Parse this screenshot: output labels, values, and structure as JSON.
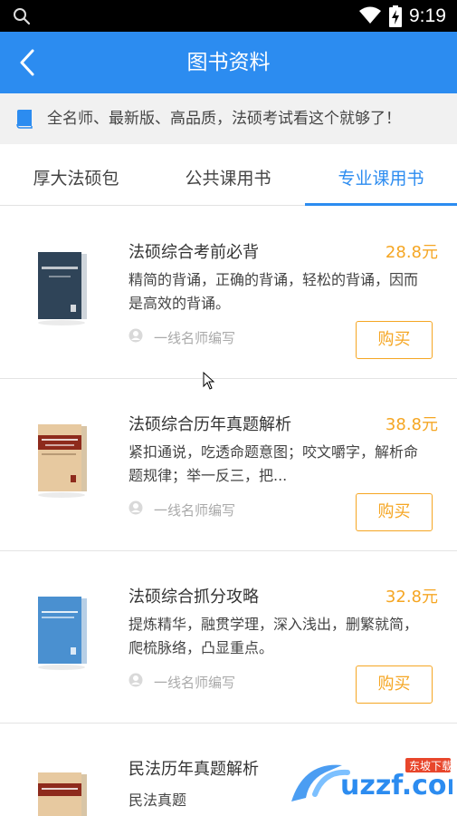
{
  "status_bar": {
    "time": "9:19"
  },
  "header": {
    "title": "图书资料"
  },
  "notice": {
    "text": "全名师、最新版、高品质，法硕考试看这个就够了！"
  },
  "tabs": [
    {
      "label": "厚大法硕包",
      "active": false
    },
    {
      "label": "公共课用书",
      "active": false
    },
    {
      "label": "专业课用书",
      "active": true
    }
  ],
  "books": [
    {
      "title": "法硕综合考前必背",
      "price": "28.8元",
      "description": "精简的背诵，正确的背诵，轻松的背诵，因而是高效的背诵。",
      "author": "一线名师编写",
      "buy_label": "购买",
      "cover_color": "#2f4458"
    },
    {
      "title": "法硕综合历年真题解析",
      "price": "38.8元",
      "description": "紧扣通说，吃透命题意图；咬文嚼字，解析命题规律；举一反三，把...",
      "author": "一线名师编写",
      "buy_label": "购买",
      "cover_color": "#e7c9a0"
    },
    {
      "title": "法硕综合抓分攻略",
      "price": "32.8元",
      "description": "提炼精华，融贯学理，深入浅出，删繁就简，爬梳脉络，凸显重点。",
      "author": "一线名师编写",
      "buy_label": "购买",
      "cover_color": "#4a90d0"
    },
    {
      "title": "民法历年真题解析",
      "price": "",
      "description": "民法真题",
      "author": "",
      "buy_label": "",
      "cover_color": "#e7c9a0"
    }
  ],
  "watermark": {
    "text": "uzzf.com",
    "subtext": "东坡下载"
  },
  "colors": {
    "primary": "#2c8cf0",
    "accent": "#f5a623"
  }
}
